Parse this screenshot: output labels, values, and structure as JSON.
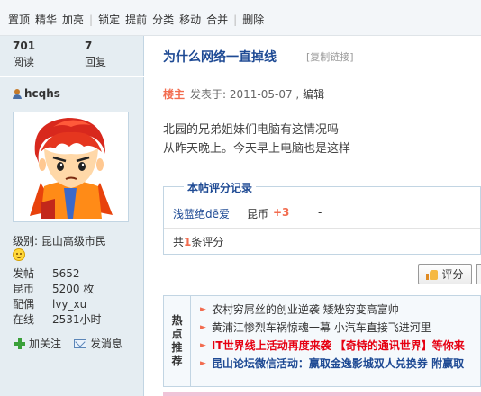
{
  "toolbar": {
    "actions": [
      "置顶",
      "精华",
      "加亮",
      "锁定",
      "提前",
      "分类",
      "移动",
      "合并",
      "删除"
    ]
  },
  "stats": {
    "views": "701",
    "views_label": "阅读",
    "replies": "7",
    "replies_label": "回复"
  },
  "thread": {
    "title": "为什么网络一直掉线",
    "copy_link": "[复制链接]"
  },
  "profile": {
    "username": "hcqhs",
    "rank": "级别: 昆山高级市民",
    "fields": [
      {
        "k": "发帖",
        "v": "5652"
      },
      {
        "k": "昆币",
        "v": "5200 枚"
      },
      {
        "k": "配偶",
        "v": "lvy_xu"
      },
      {
        "k": "在线",
        "v": "2531小时"
      }
    ],
    "follow": "加关注",
    "message": "发消息"
  },
  "post": {
    "floor": "楼主",
    "posted": "发表于: 2011-05-07 , ",
    "edit": "编辑",
    "lines": [
      "北园的兄弟姐妹们电脑有这情况吗",
      "从昨天晚上。今天早上电脑也是这样"
    ]
  },
  "rating": {
    "title": "本帖评分记录",
    "user": "浅蓝绝dē爱",
    "currency": "昆币",
    "value": "+3",
    "reason": "-",
    "sum_prefix": "共",
    "sum_count": "1",
    "sum_suffix": "条评分",
    "button": "评分"
  },
  "hot": {
    "label": [
      "热",
      "点",
      "推",
      "荐"
    ],
    "items": [
      "农村穷屌丝的创业逆袭 矮矬穷变高富帅",
      "黄浦江惨烈车祸惊魂一幕 小汽车直接飞进河里",
      "IT世界线上活动再度来袭 【奇特的通讯世界】等你来",
      "昆山论坛微信活动：赢取金逸影城双人兑换券 附赢取"
    ]
  },
  "colors": {
    "link": "#1e4a94",
    "accent": "#f26c4f",
    "panel": "#e5edf2"
  }
}
